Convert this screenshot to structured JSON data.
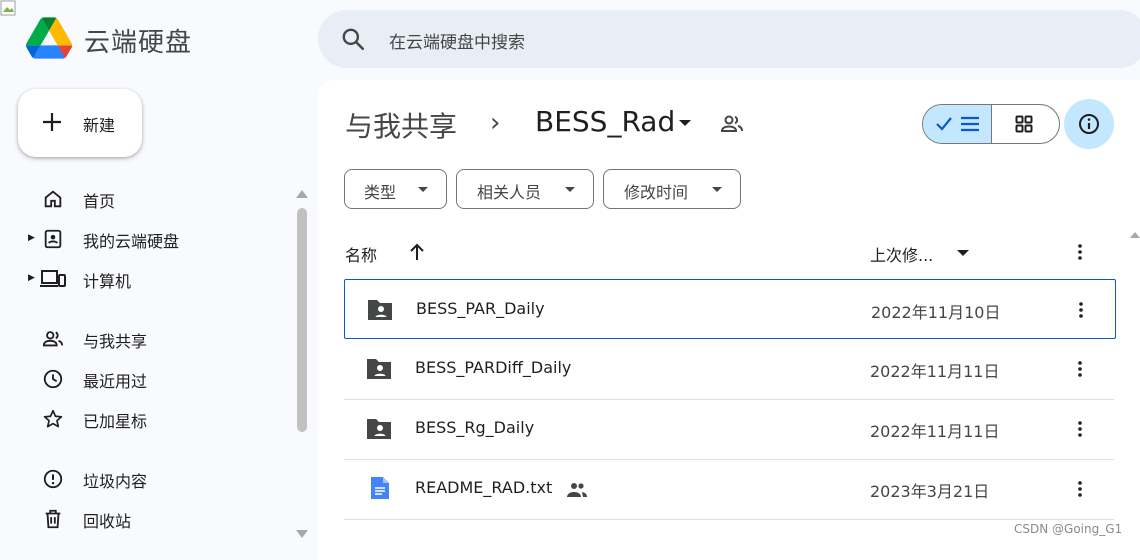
{
  "app": {
    "title": "云端硬盘",
    "search_placeholder": "在云端硬盘中搜索"
  },
  "new_button": {
    "label": "新建"
  },
  "sidebar": {
    "items": [
      {
        "label": "首页",
        "icon": "home-icon"
      },
      {
        "label": "我的云端硬盘",
        "icon": "my-drive-icon",
        "expandable": true
      },
      {
        "label": "计算机",
        "icon": "computers-icon",
        "expandable": true
      },
      {
        "label": "与我共享",
        "icon": "shared-with-me-icon"
      },
      {
        "label": "最近用过",
        "icon": "recent-icon"
      },
      {
        "label": "已加星标",
        "icon": "star-icon"
      },
      {
        "label": "垃圾内容",
        "icon": "spam-icon"
      },
      {
        "label": "回收站",
        "icon": "trash-icon"
      }
    ]
  },
  "breadcrumb": {
    "parent": "与我共享",
    "separator": "›",
    "current": "BESS_Rad"
  },
  "filters": [
    {
      "label": "类型"
    },
    {
      "label": "相关人员"
    },
    {
      "label": "修改时间"
    }
  ],
  "table": {
    "columns": {
      "name": "名称",
      "modified": "上次修..."
    },
    "rows": [
      {
        "name": "BESS_PAR_Daily",
        "type": "shared-folder",
        "modified": "2022年11月10日",
        "selected": true
      },
      {
        "name": "BESS_PARDiff_Daily",
        "type": "shared-folder",
        "modified": "2022年11月11日"
      },
      {
        "name": "BESS_Rg_Daily",
        "type": "shared-folder",
        "modified": "2022年11月11日"
      },
      {
        "name": "README_RAD.txt",
        "type": "doc",
        "modified": "2023年3月21日",
        "shared": true
      }
    ]
  },
  "watermark": "CSDN @Going_G1",
  "colors": {
    "accent": "#0b57d0",
    "selected_bg": "#c2e7ff",
    "search_bg": "#e9eef6",
    "page_bg": "#f8fafd"
  }
}
